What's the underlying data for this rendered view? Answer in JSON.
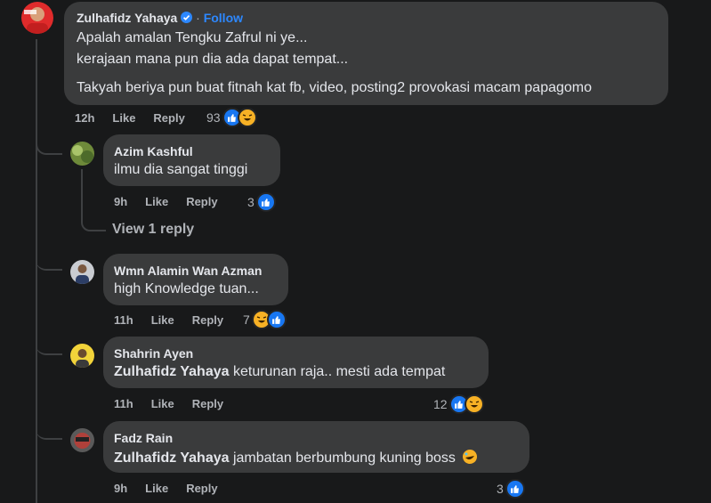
{
  "colors": {
    "background": "#18191a",
    "bubble": "#3a3b3c",
    "accent": "#2d88ff",
    "text": "#e4e6eb",
    "meta": "#b0b3b8",
    "like": "#1877f2",
    "haha": "#f7b125"
  },
  "main_comment": {
    "author": "Zulhafidz Yahaya",
    "verified_icon": "verified-badge-icon",
    "separator": "·",
    "follow_label": "Follow",
    "lines": [
      "Apalah amalan Tengku Zafrul ni ye...",
      "kerajaan mana pun dia ada dapat tempat...",
      "Takyah beriya pun buat fitnah kat fb, video, posting2 provokasi macam papagomo"
    ],
    "time": "12h",
    "like_label": "Like",
    "reply_label": "Reply",
    "reaction_count": "93",
    "reactions": [
      "like-icon",
      "haha-icon"
    ]
  },
  "replies": [
    {
      "author": "Azim Kashful",
      "text": "ilmu dia sangat tinggi",
      "time": "9h",
      "like_label": "Like",
      "reply_label": "Reply",
      "reaction_count": "3",
      "reactions": [
        "like-icon"
      ]
    },
    {
      "author": "Wmn Alamin Wan Azman",
      "text": "high Knowledge tuan...",
      "time": "11h",
      "like_label": "Like",
      "reply_label": "Reply",
      "reaction_count": "7",
      "reactions": [
        "haha-icon",
        "like-icon"
      ]
    },
    {
      "author": "Shahrin Ayen",
      "mention": "Zulhafidz Yahaya",
      "text": " keturunan raja.. mesti ada tempat",
      "time": "11h",
      "like_label": "Like",
      "reply_label": "Reply",
      "reaction_count": "12",
      "reactions": [
        "like-icon",
        "haha-icon"
      ]
    },
    {
      "author": "Fadz Rain",
      "mention": "Zulhafidz Yahaya",
      "text": " jambatan berbumbung kuning boss",
      "trailing_emoji": "rolling-laughing-emoji",
      "time": "9h",
      "like_label": "Like",
      "reply_label": "Reply",
      "reaction_count": "3",
      "reactions": [
        "like-icon"
      ]
    }
  ],
  "view_replies_label": "View 1 reply"
}
